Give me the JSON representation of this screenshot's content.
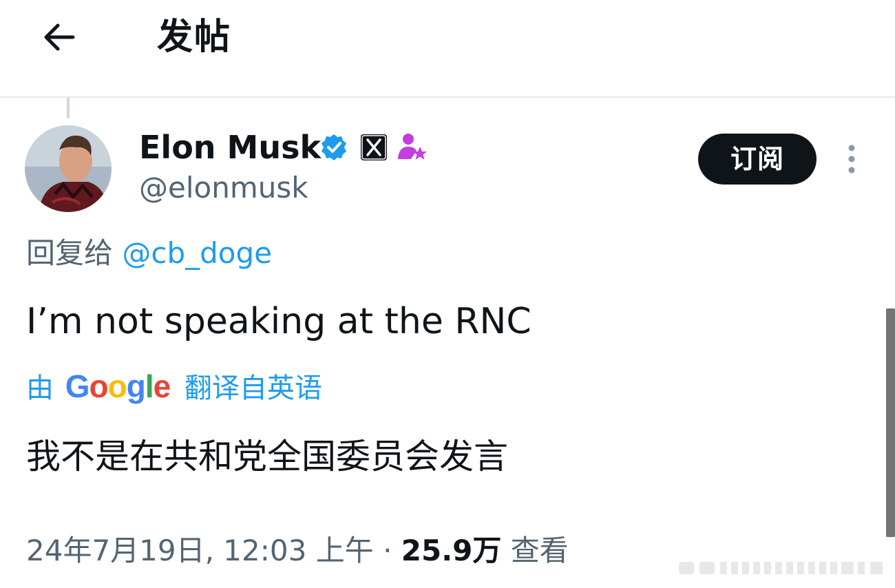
{
  "header": {
    "back_icon": "arrow-left-icon",
    "title": "发帖"
  },
  "post": {
    "author": {
      "name": "Elon Musk",
      "handle": "@elonmusk",
      "avatar": "avatar-photo",
      "badges": [
        "verified-badge-icon",
        "x-affiliation-icon",
        "subscriber-icon"
      ]
    },
    "subscribe_label": "订阅",
    "more_icon": "more-vertical-icon",
    "reply_prefix": "回复给",
    "reply_to": "@cb_doge",
    "text": "I’m not speaking at the RNC",
    "translation": {
      "by": "由",
      "provider": "Google",
      "label": "翻译自英语",
      "text": "我不是在共和党全国委员会发言"
    },
    "meta": {
      "timestamp": "24年7月19日, 12:03 上午",
      "separator": "·",
      "views_count": "25.9万",
      "views_label": "查看"
    }
  },
  "colors": {
    "text": "#0f1419",
    "secondary": "#536471",
    "link": "#1d9bf0",
    "verified": "#1d9bf0",
    "subscriber": "#c13fe0",
    "google_blue": "#4285f4",
    "google_red": "#ea4335",
    "google_yellow": "#fbbc05",
    "google_green": "#34a853"
  }
}
